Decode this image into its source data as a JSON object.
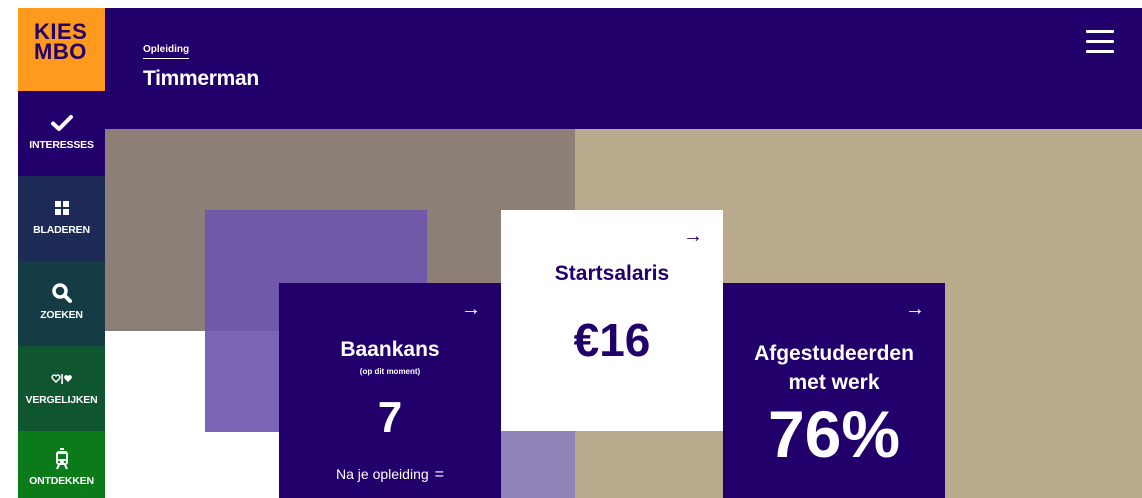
{
  "header": {
    "logo_line1": "KIES",
    "logo_line2": "MBO",
    "breadcrumb": "Opleiding",
    "title": "Timmerman",
    "menu_icon": "hamburger-menu-icon"
  },
  "sidebar": {
    "items": [
      {
        "label": "INTERESSES",
        "icon": "check-icon",
        "color": "#21006b"
      },
      {
        "label": "BLADEREN",
        "icon": "grid-icon",
        "color": "#1c2a55"
      },
      {
        "label": "ZOEKEN",
        "icon": "search-icon",
        "color": "#153c45"
      },
      {
        "label": "VERGELIJKEN",
        "icon": "compare-hearts-icon",
        "color": "#0f5530"
      },
      {
        "label": "ONTDEKKEN",
        "icon": "tram-icon",
        "color": "#0b7a19"
      }
    ]
  },
  "cards": {
    "baankans": {
      "title": "Baankans",
      "subtitle": "(op dit moment)",
      "value": "7",
      "footer": "Na je opleiding",
      "footer_symbol": "="
    },
    "startsalaris": {
      "title": "Startsalaris",
      "value": "€16"
    },
    "afgestudeerden": {
      "title_line1": "Afgestudeerden",
      "title_line2": "met werk",
      "value": "76%"
    },
    "arrow": "→"
  },
  "colors": {
    "brand_purple": "#21006b",
    "logo_orange": "#ff9a1f",
    "overlay_purple": "#6c55ad"
  }
}
